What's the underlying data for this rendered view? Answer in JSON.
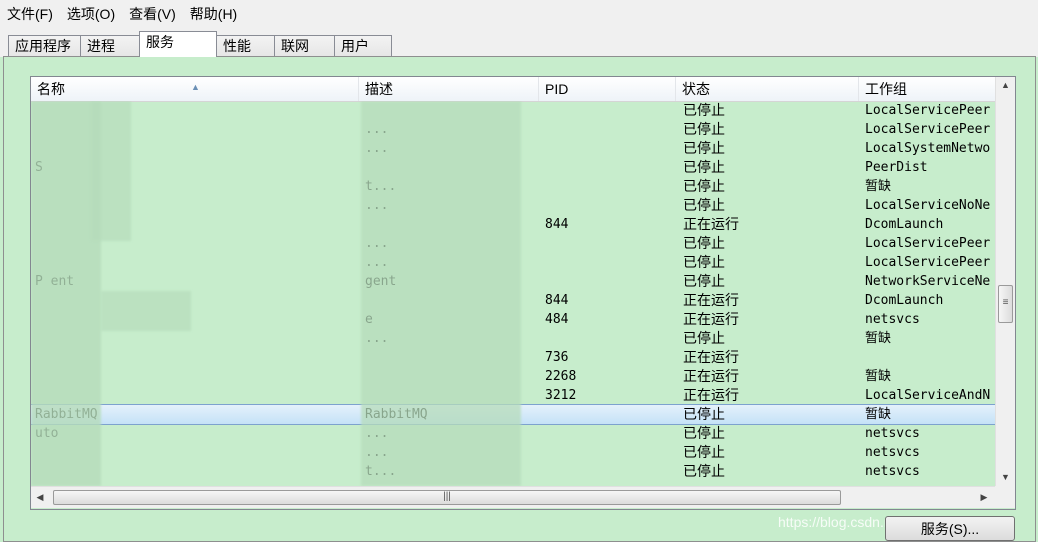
{
  "menu": [
    "文件(F)",
    "选项(O)",
    "查看(V)",
    "帮助(H)"
  ],
  "tabs": [
    {
      "label": "应用程序",
      "active": false
    },
    {
      "label": "进程",
      "active": false
    },
    {
      "label": "服务",
      "active": true
    },
    {
      "label": "性能",
      "active": false
    },
    {
      "label": "联网",
      "active": false
    },
    {
      "label": "用户",
      "active": false
    }
  ],
  "columns": [
    "名称",
    "描述",
    "PID",
    "状态",
    "工作组"
  ],
  "rows": [
    {
      "name": "",
      "desc": "",
      "pid": "",
      "state": "已停止",
      "group": "LocalServicePeer"
    },
    {
      "name": "",
      "desc": "...",
      "pid": "",
      "state": "已停止",
      "group": "LocalServicePeer"
    },
    {
      "name": "",
      "desc": "...",
      "pid": "",
      "state": "已停止",
      "group": "LocalSystemNetwo"
    },
    {
      "name": "S",
      "desc": "",
      "pid": "",
      "state": "已停止",
      "group": "PeerDist"
    },
    {
      "name": "",
      "desc": "t...",
      "pid": "",
      "state": "已停止",
      "group": "暂缺"
    },
    {
      "name": "",
      "desc": "...",
      "pid": "",
      "state": "已停止",
      "group": "LocalServiceNoNe"
    },
    {
      "name": "",
      "desc": "",
      "pid": "844",
      "state": "正在运行",
      "group": "DcomLaunch"
    },
    {
      "name": "",
      "desc": "...",
      "pid": "",
      "state": "已停止",
      "group": "LocalServicePeer"
    },
    {
      "name": "",
      "desc": "...",
      "pid": "",
      "state": "已停止",
      "group": "LocalServicePeer"
    },
    {
      "name": "P    ent",
      "desc": "gent",
      "pid": "",
      "state": "已停止",
      "group": "NetworkServiceNe"
    },
    {
      "name": "",
      "desc": "",
      "pid": "844",
      "state": "正在运行",
      "group": "DcomLaunch"
    },
    {
      "name": "",
      "desc": "e",
      "pid": "484",
      "state": "正在运行",
      "group": "netsvcs"
    },
    {
      "name": "",
      "desc": "...",
      "pid": "",
      "state": "已停止",
      "group": "暂缺"
    },
    {
      "name": "",
      "desc": "",
      "pid": "736",
      "state": "正在运行",
      "group": ""
    },
    {
      "name": "",
      "desc": "",
      "pid": "2268",
      "state": "正在运行",
      "group": "暂缺"
    },
    {
      "name": "",
      "desc": "",
      "pid": "3212",
      "state": "正在运行",
      "group": "LocalServiceAndN"
    },
    {
      "name": "RabbitMQ",
      "desc": "RabbitMQ",
      "pid": "",
      "state": "已停止",
      "group": "暂缺",
      "selected": true
    },
    {
      "name": "  uto",
      "desc": "...",
      "pid": "",
      "state": "已停止",
      "group": "netsvcs"
    },
    {
      "name": "",
      "desc": "...",
      "pid": "",
      "state": "已停止",
      "group": "netsvcs"
    },
    {
      "name": "",
      "desc": "t...",
      "pid": "",
      "state": "已停止",
      "group": "netsvcs"
    }
  ],
  "services_button": "服务(S)...",
  "watermark": "https://blog.csdn.net/u01032724891",
  "colors": {
    "background": "#c7edcc",
    "selection": "#c5e2f7"
  }
}
